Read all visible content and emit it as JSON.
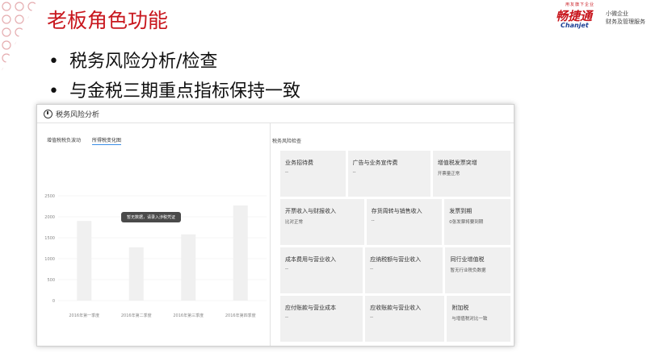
{
  "slide": {
    "title": "老板角色功能",
    "bullets": [
      "税务风险分析/检查",
      "与金税三期重点指标保持一致"
    ],
    "bullet_symbol": "•"
  },
  "brand": {
    "tagline": "用友旗下企业",
    "logo_cn": "畅捷通",
    "logo_en": "Chanjet",
    "slogan_line1": "小微企业",
    "slogan_line2": "财务及管理服务",
    "color": "#c8161d"
  },
  "screenshot": {
    "header_title": "税务风险分析",
    "left_tabs": [
      "增值税税负波动",
      "所得税变化图"
    ],
    "empty_tip": "暂无数据，请录入涉税凭证",
    "right_title": "税务风险检查",
    "cells": [
      [
        {
          "label": "业务招待费",
          "value": "--"
        },
        {
          "label": "广告与业务宣传费",
          "value": "--"
        },
        {
          "label": "增值税发票突增",
          "value": "开票量正常"
        }
      ],
      [
        {
          "label": "开票收入与财报收入",
          "value": "比对正常"
        },
        {
          "label": "存货周转与销售收入",
          "value": "--"
        },
        {
          "label": "发票到期",
          "value": "0张发票将要到期"
        }
      ],
      [
        {
          "label": "成本费用与营业收入",
          "value": "--"
        },
        {
          "label": "应纳税额与营业收入",
          "value": "--"
        },
        {
          "label": "同行业增值税",
          "value": "暂无行业税负数据"
        }
      ],
      [
        {
          "label": "应付账款与营业成本",
          "value": "--"
        },
        {
          "label": "应收账款与营业收入",
          "value": "--"
        },
        {
          "label": "附加税",
          "value": "与增值税对比一致"
        }
      ]
    ]
  },
  "chart_data": {
    "type": "bar",
    "categories": [
      "2016年第一季度",
      "2016年第二季度",
      "2016年第三季度",
      "2016年第四季度"
    ],
    "values": [
      1900,
      1270,
      1580,
      2270
    ],
    "yticks": [
      0,
      500,
      1000,
      1500,
      2000,
      2500
    ],
    "ylim": [
      0,
      2500
    ],
    "bar_color": "#f0f0f0",
    "grid": true
  }
}
